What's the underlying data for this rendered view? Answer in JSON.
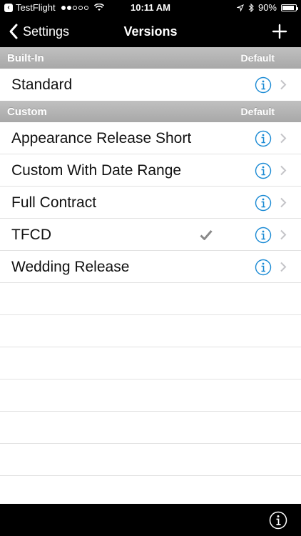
{
  "status_bar": {
    "back_app": "TestFlight",
    "time": "10:11 AM",
    "battery_percent": "90%",
    "battery_level": 0.9,
    "signal_dots_filled": 2,
    "signal_dots_total": 5
  },
  "nav": {
    "back_label": "Settings",
    "title": "Versions",
    "add_icon": "plus-icon"
  },
  "sections": {
    "builtin": {
      "title": "Built-In",
      "column": "Default",
      "rows": [
        {
          "label": "Standard",
          "checked": false
        }
      ]
    },
    "custom": {
      "title": "Custom",
      "column": "Default",
      "rows": [
        {
          "label": "Appearance Release Short",
          "checked": false
        },
        {
          "label": "Custom With Date Range",
          "checked": false
        },
        {
          "label": "Full Contract",
          "checked": false
        },
        {
          "label": "TFCD",
          "checked": true
        },
        {
          "label": "Wedding Release",
          "checked": false
        }
      ]
    }
  },
  "colors": {
    "accent": "#1a8ad4",
    "section_header": "#b0b0b0",
    "bar_background": "#000000"
  }
}
